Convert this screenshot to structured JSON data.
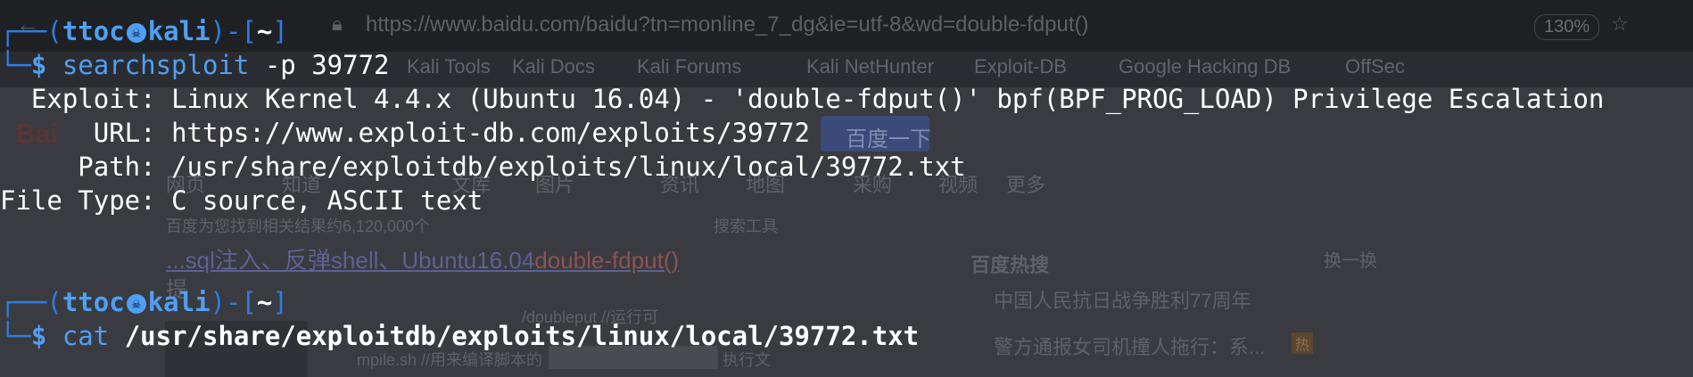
{
  "background_browser": {
    "url": "https://www.baidu.com/baidu?tn=monline_7_dg&ie=utf-8&wd=double-fdput()",
    "zoom": "130%",
    "bookmarks": [
      "Kali Tools",
      "Kali Docs",
      "Kali Forums",
      "Kali NetHunter",
      "Exploit-DB",
      "Google Hacking DB",
      "OffSec"
    ],
    "search_button": "百度一下",
    "tabs": [
      "网页",
      "知道",
      "文库",
      "图片",
      "资讯",
      "地图",
      "采购",
      "视频",
      "更多"
    ],
    "result_count": "百度为您找到相关结果约6,120,000个",
    "search_tools": "搜索工具",
    "result_title_prefix": "...sql注入、反弹shell、Ubuntu16.04",
    "result_title_highlight": "double-fdput()",
    "result_title_suffix": "提",
    "hot_title": "百度热搜",
    "refresh": "换一换",
    "hot_items": [
      "中国人民抗日战争胜利77周年",
      "警方通报女司机撞人拖行：系..."
    ],
    "snippet_1": "/doubleput //运行可",
    "snippet_2": "mpile.sh //用来编译脚本的",
    "snippet_3": "执行文"
  },
  "terminal": {
    "prompt_user": "ttoc",
    "prompt_host": "kali",
    "prompt_dir": "~",
    "command_1": "searchsploit",
    "command_1_args": "-p 39772",
    "output": {
      "exploit_label": "  Exploit:",
      "exploit_value": " Linux Kernel 4.4.x (Ubuntu 16.04) - 'double-fdput()' bpf(BPF_PROG_LOAD) Privilege Escalation",
      "url_label": "      URL:",
      "url_value": " https://www.exploit-db.com/exploits/39772",
      "path_label": "     Path:",
      "path_value": " /usr/share/exploitdb/exploits/linux/local/39772.txt",
      "filetype_label": "File Type:",
      "filetype_value": " C source, ASCII text"
    },
    "command_2": "cat",
    "command_2_args": "/usr/share/exploitdb/exploits/linux/local/39772.txt"
  },
  "colors": {
    "prompt_frame": "#2c7ee0",
    "prompt_user": "#4f9ff5",
    "text": "#ffffff"
  }
}
